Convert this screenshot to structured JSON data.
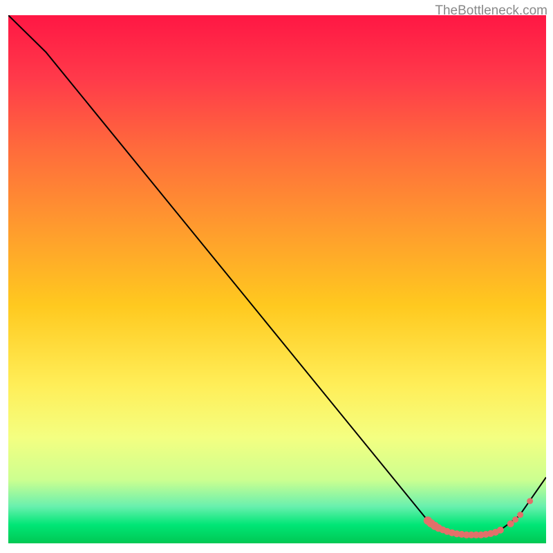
{
  "watermark": "TheBottleneck.com",
  "chart_data": {
    "type": "line",
    "title": "",
    "xlabel": "",
    "ylabel": "",
    "xlim": [
      0,
      100
    ],
    "ylim": [
      0,
      100
    ],
    "curve": [
      {
        "x": 0,
        "y": 100
      },
      {
        "x": 7,
        "y": 93
      },
      {
        "x": 78,
        "y": 4.3
      },
      {
        "x": 80,
        "y": 2.9
      },
      {
        "x": 82,
        "y": 2.0
      },
      {
        "x": 85,
        "y": 1.6
      },
      {
        "x": 88,
        "y": 1.6
      },
      {
        "x": 90,
        "y": 2.0
      },
      {
        "x": 92,
        "y": 2.9
      },
      {
        "x": 95,
        "y": 5.2
      },
      {
        "x": 100,
        "y": 12.5
      }
    ],
    "markers": [
      {
        "x": 78.0,
        "y": 4.3,
        "r": 6
      },
      {
        "x": 78.6,
        "y": 3.8,
        "r": 6
      },
      {
        "x": 79.3,
        "y": 3.3,
        "r": 6
      },
      {
        "x": 80.0,
        "y": 2.9,
        "r": 5.5
      },
      {
        "x": 80.8,
        "y": 2.55,
        "r": 5
      },
      {
        "x": 81.6,
        "y": 2.25,
        "r": 5
      },
      {
        "x": 82.5,
        "y": 2.0,
        "r": 5
      },
      {
        "x": 83.4,
        "y": 1.8,
        "r": 5
      },
      {
        "x": 84.3,
        "y": 1.7,
        "r": 5
      },
      {
        "x": 85.2,
        "y": 1.6,
        "r": 5
      },
      {
        "x": 86.1,
        "y": 1.6,
        "r": 5
      },
      {
        "x": 87.0,
        "y": 1.6,
        "r": 5
      },
      {
        "x": 87.9,
        "y": 1.6,
        "r": 5
      },
      {
        "x": 88.8,
        "y": 1.7,
        "r": 5
      },
      {
        "x": 89.7,
        "y": 1.85,
        "r": 5
      },
      {
        "x": 90.6,
        "y": 2.1,
        "r": 5
      },
      {
        "x": 91.5,
        "y": 2.5,
        "r": 5
      },
      {
        "x": 93.4,
        "y": 3.7,
        "r": 5
      },
      {
        "x": 94.3,
        "y": 4.5,
        "r": 4.5
      },
      {
        "x": 95.2,
        "y": 5.4,
        "r": 4.5
      },
      {
        "x": 97.0,
        "y": 8.0,
        "r": 4.5
      }
    ],
    "marker_color": "#E2706A",
    "line_color": "#000000",
    "gradient_stops": [
      {
        "offset": 0,
        "color": "#FF1744"
      },
      {
        "offset": 12,
        "color": "#FF3A4A"
      },
      {
        "offset": 25,
        "color": "#FF6A3C"
      },
      {
        "offset": 40,
        "color": "#FF9A2E"
      },
      {
        "offset": 55,
        "color": "#FFC91F"
      },
      {
        "offset": 70,
        "color": "#FFEE58"
      },
      {
        "offset": 80,
        "color": "#F4FF81"
      },
      {
        "offset": 88,
        "color": "#CCFF90"
      },
      {
        "offset": 93,
        "color": "#69F0AE"
      },
      {
        "offset": 96.5,
        "color": "#00E676"
      },
      {
        "offset": 100,
        "color": "#00C853"
      }
    ]
  }
}
